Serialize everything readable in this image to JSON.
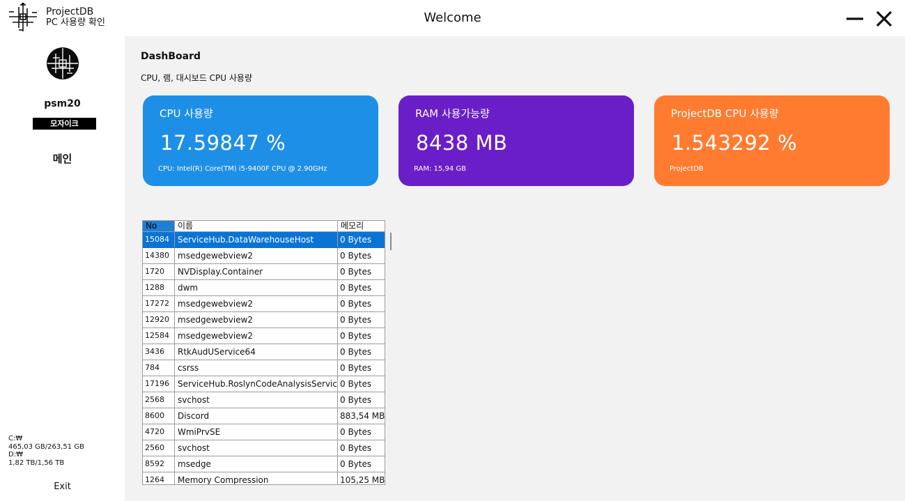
{
  "titlebar": {
    "app_name": "ProjectDB",
    "app_subtitle": "PC 사용량 확인",
    "window_title": "Welcome"
  },
  "sidebar": {
    "username": "psm20",
    "role": "모자이크",
    "nav_main": "메인",
    "disk_c_label": "C:₩",
    "disk_c_usage": "465,03 GB/263,51 GB",
    "disk_d_label": "D:₩",
    "disk_d_usage": "1,82 TB/1,56 TB",
    "exit_label": "Exit"
  },
  "dashboard": {
    "title": "DashBoard",
    "subtitle": "CPU, 램, 대시보드 CPU 사용량"
  },
  "cards": [
    {
      "title": "CPU 사용량",
      "value": "17.59847 %",
      "footer": "CPU: Intel(R) Core(TM) i5-9400F CPU @ 2.90GHz",
      "color": "#1e8fe6"
    },
    {
      "title": "RAM 사용가능량",
      "value": "8438 MB",
      "footer": "RAM: 15,94 GB",
      "color": "#6a1ec8"
    },
    {
      "title": "ProjectDB CPU 사용량",
      "value": "1.543292 %",
      "footer": "ProjectDB",
      "color": "#ff7b30"
    }
  ],
  "process_table": {
    "columns": [
      "No",
      "이름",
      "메모리"
    ],
    "rows": [
      {
        "no": "15084",
        "name": "ServiceHub.DataWarehouseHost",
        "mem": "0 Bytes",
        "selected": true
      },
      {
        "no": "14380",
        "name": "msedgewebview2",
        "mem": "0 Bytes"
      },
      {
        "no": "1720",
        "name": "NVDisplay.Container",
        "mem": "0 Bytes"
      },
      {
        "no": "1288",
        "name": "dwm",
        "mem": "0 Bytes"
      },
      {
        "no": "17272",
        "name": "msedgewebview2",
        "mem": "0 Bytes"
      },
      {
        "no": "12920",
        "name": "msedgewebview2",
        "mem": "0 Bytes"
      },
      {
        "no": "12584",
        "name": "msedgewebview2",
        "mem": "0 Bytes"
      },
      {
        "no": "3436",
        "name": "RtkAudUService64",
        "mem": "0 Bytes"
      },
      {
        "no": "784",
        "name": "csrss",
        "mem": "0 Bytes"
      },
      {
        "no": "17196",
        "name": "ServiceHub.RoslynCodeAnalysisService",
        "mem": "0 Bytes"
      },
      {
        "no": "2568",
        "name": "svchost",
        "mem": "0 Bytes"
      },
      {
        "no": "8600",
        "name": "Discord",
        "mem": "883,54 MB"
      },
      {
        "no": "4720",
        "name": "WmiPrvSE",
        "mem": "0 Bytes"
      },
      {
        "no": "2560",
        "name": "svchost",
        "mem": "0 Bytes"
      },
      {
        "no": "8592",
        "name": "msedge",
        "mem": "0 Bytes"
      },
      {
        "no": "1264",
        "name": "Memory Compression",
        "mem": "105,25 MB"
      }
    ]
  },
  "icons": {
    "logo": "circuit-logo-icon",
    "minimize": "minimize-icon",
    "close": "close-icon"
  }
}
